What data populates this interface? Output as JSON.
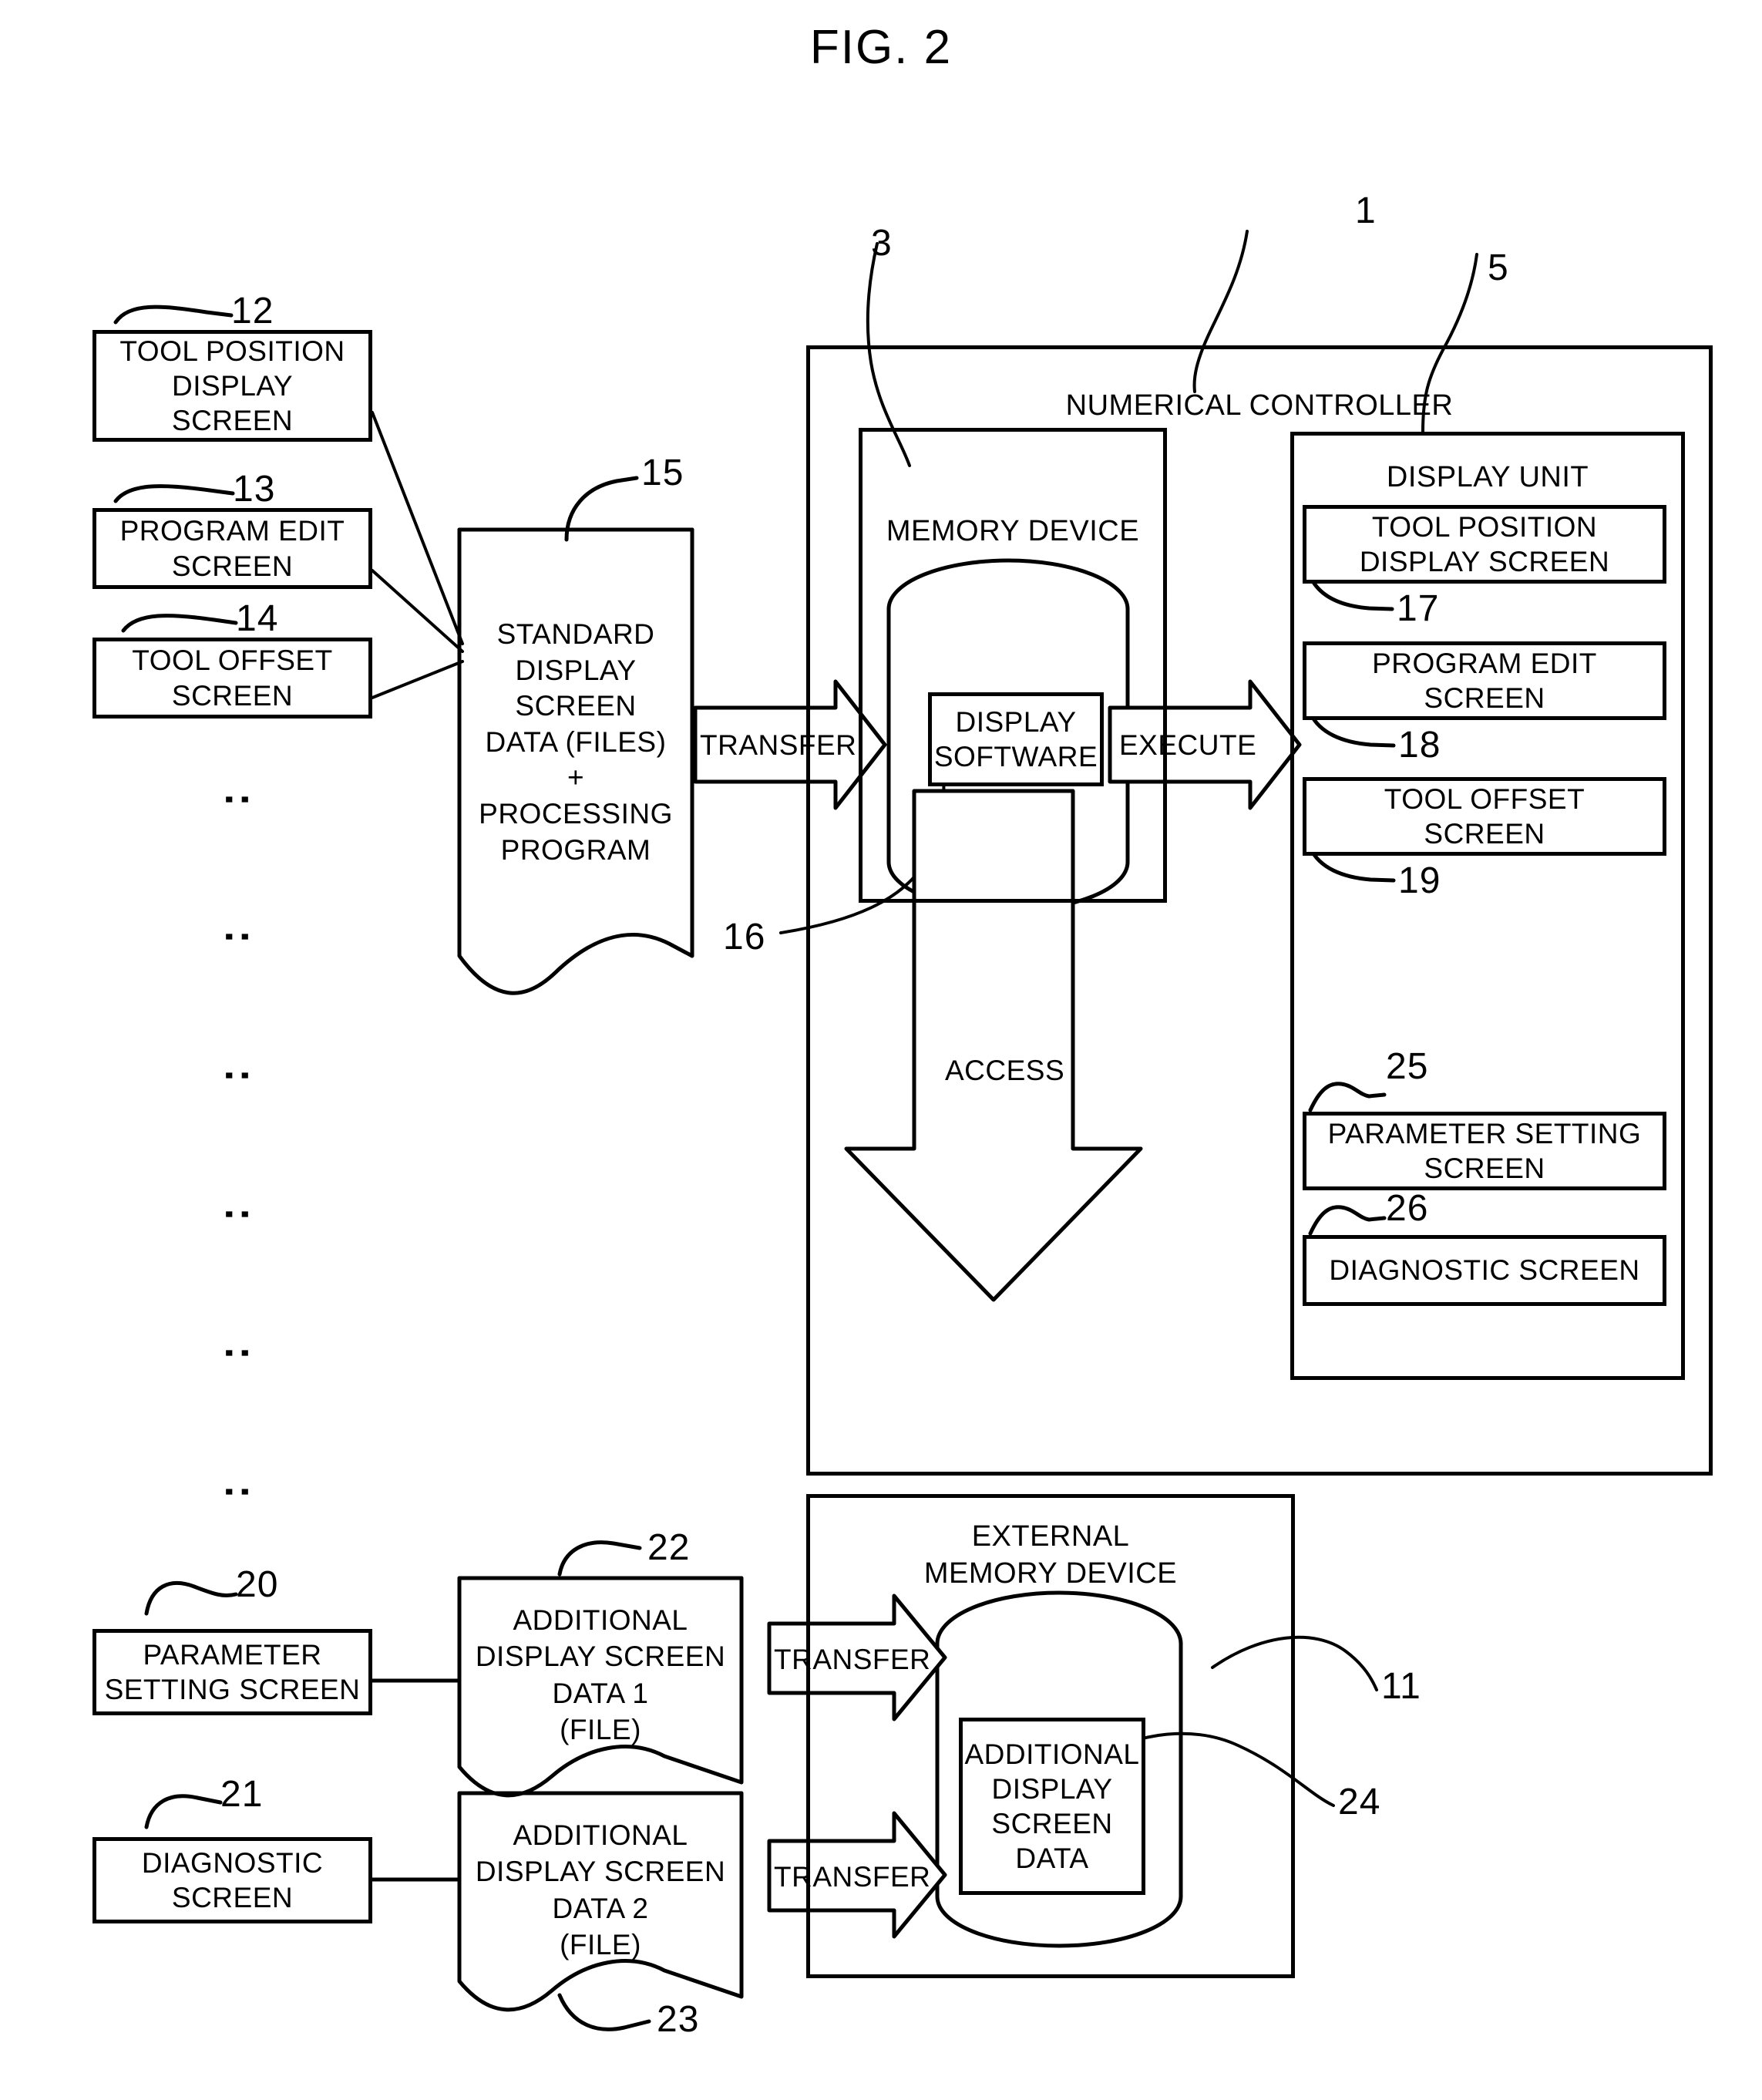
{
  "figure": {
    "title": "FIG. 2"
  },
  "left_column": {
    "boxes": [
      {
        "ref": "12",
        "lines": [
          "TOOL POSITION",
          "DISPLAY",
          "SCREEN"
        ]
      },
      {
        "ref": "13",
        "lines": [
          "PROGRAM EDIT",
          "SCREEN"
        ]
      },
      {
        "ref": "14",
        "lines": [
          "TOOL OFFSET",
          "SCREEN"
        ]
      }
    ],
    "ellipsis_glyph": "∶"
  },
  "standard_data": {
    "ref": "15",
    "lines": [
      "STANDARD",
      "DISPLAY",
      "SCREEN",
      "DATA (FILES)",
      "+",
      "PROCESSING",
      "PROGRAM"
    ]
  },
  "arrows": {
    "transfer_to_memory": "TRANSFER",
    "execute": "EXECUTE",
    "access": "ACCESS",
    "transfer_1": "TRANSFER",
    "transfer_2": "TRANSFER"
  },
  "numerical_controller": {
    "ref": "1",
    "label": "NUMERICAL CONTROLLER",
    "memory_device": {
      "ref": "3",
      "label": "MEMORY DEVICE",
      "display_software": {
        "ref": "16",
        "lines": [
          "DISPLAY",
          "SOFTWARE"
        ]
      }
    },
    "display_unit": {
      "ref": "5",
      "label": "DISPLAY UNIT",
      "screens": [
        {
          "ref": "17",
          "lines": [
            "TOOL POSITION",
            "DISPLAY SCREEN"
          ]
        },
        {
          "ref": "18",
          "lines": [
            "PROGRAM EDIT",
            "SCREEN"
          ]
        },
        {
          "ref": "19",
          "lines": [
            "TOOL OFFSET",
            "SCREEN"
          ]
        },
        {
          "ref": "25",
          "lines": [
            "PARAMETER SETTING",
            "SCREEN"
          ]
        },
        {
          "ref": "26",
          "lines": [
            "DIAGNOSTIC SCREEN"
          ]
        }
      ]
    }
  },
  "external_memory": {
    "ref": "11",
    "label_lines": [
      "EXTERNAL",
      "MEMORY DEVICE"
    ],
    "stored_data": {
      "ref": "24",
      "lines": [
        "ADDITIONAL",
        "DISPLAY",
        "SCREEN",
        "DATA"
      ]
    }
  },
  "bottom_left": {
    "screens": [
      {
        "ref": "20",
        "lines": [
          "PARAMETER",
          "SETTING SCREEN"
        ]
      },
      {
        "ref": "21",
        "lines": [
          "DIAGNOSTIC",
          "SCREEN"
        ]
      }
    ],
    "files": [
      {
        "ref": "22",
        "lines": [
          "ADDITIONAL",
          "DISPLAY SCREEN",
          "DATA 1",
          "(FILE)"
        ]
      },
      {
        "ref": "23",
        "lines": [
          "ADDITIONAL",
          "DISPLAY SCREEN",
          "DATA 2",
          "(FILE)"
        ]
      }
    ]
  },
  "colors": {
    "stroke": "#000000",
    "background": "#ffffff"
  }
}
